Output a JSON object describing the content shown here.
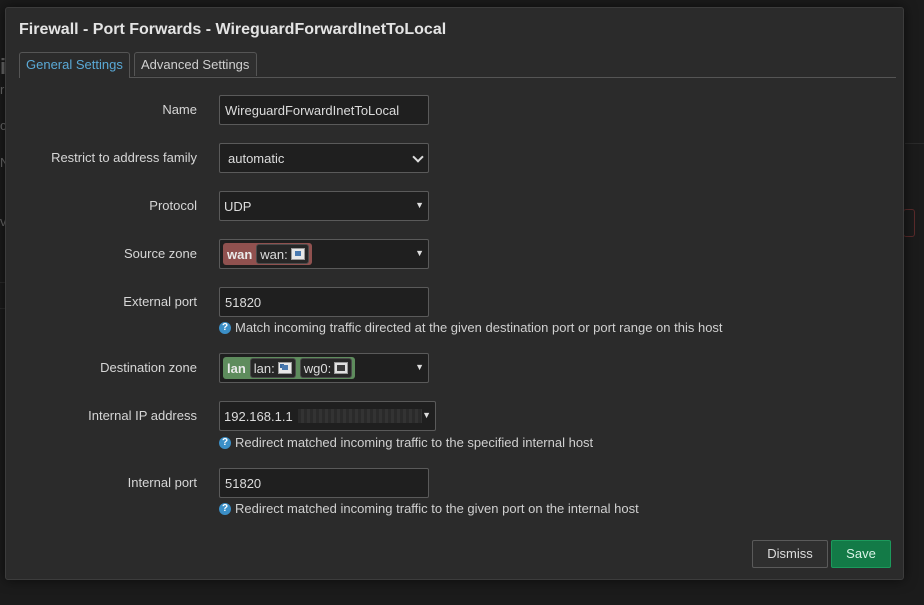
{
  "modal": {
    "title": "Firewall - Port Forwards - WireguardForwardInetToLocal"
  },
  "tabs": [
    {
      "label": "General Settings",
      "active": true
    },
    {
      "label": "Advanced Settings",
      "active": false
    }
  ],
  "fields": {
    "name": {
      "label": "Name",
      "value": "WireguardForwardInetToLocal"
    },
    "family": {
      "label": "Restrict to address family",
      "value": "automatic"
    },
    "protocol": {
      "label": "Protocol",
      "value": "UDP"
    },
    "source_zone": {
      "label": "Source zone",
      "zone": "wan",
      "zone_color": "#90514f",
      "interfaces": [
        {
          "name": "wan:",
          "icon": "ethernet-port-icon"
        }
      ]
    },
    "external_port": {
      "label": "External port",
      "value": "51820",
      "help": "Match incoming traffic directed at the given destination port or port range on this host"
    },
    "dest_zone": {
      "label": "Destination zone",
      "zone": "lan",
      "zone_color": "#5e8c5d",
      "interfaces": [
        {
          "name": "lan:",
          "icon": "bridge-icon"
        },
        {
          "name": "wg0:",
          "icon": "tunnel-icon"
        }
      ]
    },
    "internal_ip": {
      "label": "Internal IP address",
      "value": "192.168.1.1",
      "help": "Redirect matched incoming traffic to the specified internal host"
    },
    "internal_port": {
      "label": "Internal port",
      "value": "51820",
      "help": "Redirect matched incoming traffic to the given port on the internal host"
    }
  },
  "buttons": {
    "dismiss": "Dismiss",
    "save": "Save"
  },
  "colors": {
    "accent": "#5aa9d6",
    "save": "#137a47",
    "help_icon": "#3b8fc7"
  }
}
